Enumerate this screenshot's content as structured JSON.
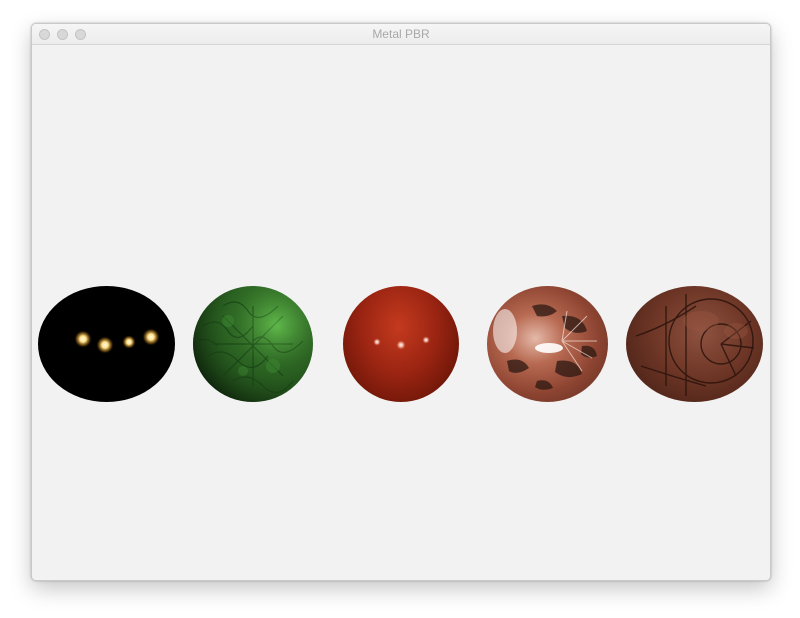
{
  "window": {
    "title": "Metal PBR"
  },
  "viewport": {
    "background_color": "#f2f2f2",
    "spheres": [
      {
        "name": "emissive-lights",
        "base_color": "#000000"
      },
      {
        "name": "green-textured",
        "base_color": "#2f6a25"
      },
      {
        "name": "glossy-red",
        "base_color": "#9a2412"
      },
      {
        "name": "copper-map",
        "base_color": "#b86a52"
      },
      {
        "name": "rusted-panels",
        "base_color": "#6e3626"
      }
    ]
  }
}
